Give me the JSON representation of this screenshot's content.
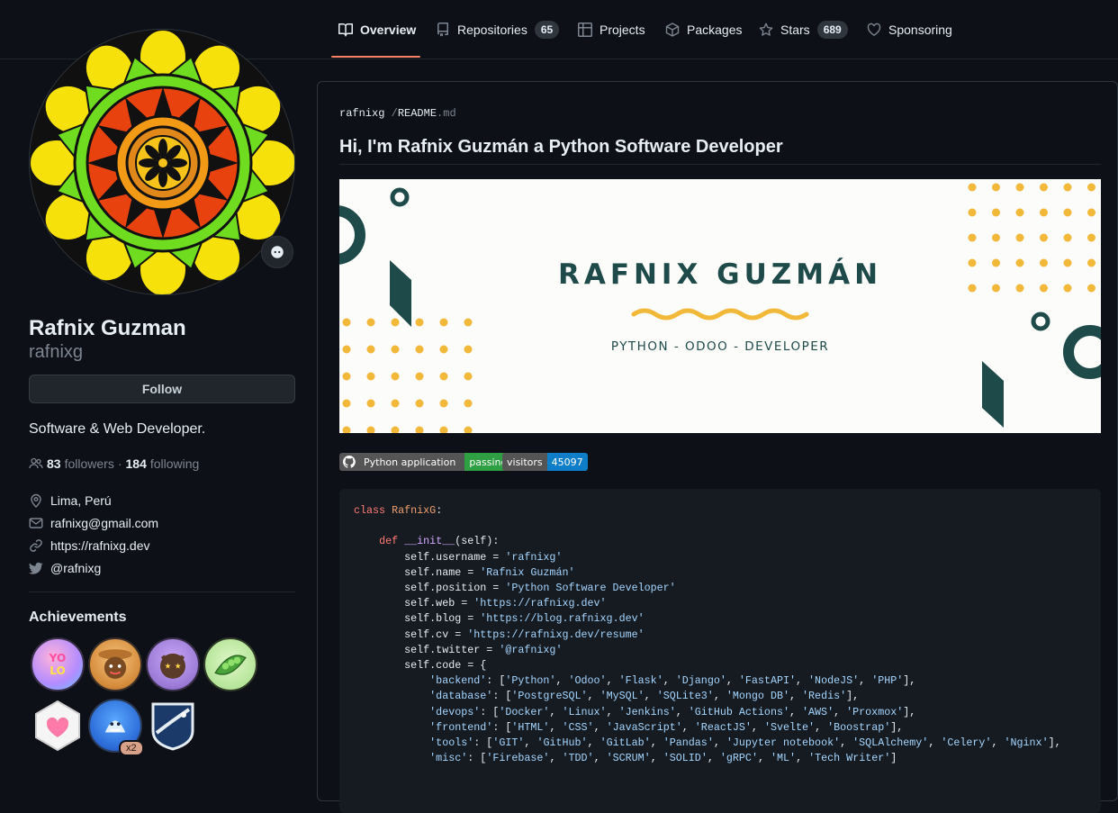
{
  "nav": {
    "tabs": [
      {
        "label": "Overview",
        "icon": "book-icon"
      },
      {
        "label": "Repositories",
        "icon": "repo-icon",
        "count": "65"
      },
      {
        "label": "Projects",
        "icon": "table-icon"
      },
      {
        "label": "Packages",
        "icon": "package-icon"
      },
      {
        "label": "Stars",
        "icon": "star-icon",
        "count": "689"
      },
      {
        "label": "Sponsoring",
        "icon": "heart-icon"
      }
    ]
  },
  "profile": {
    "name": "Rafnix Guzman",
    "login": "rafnixg",
    "follow_label": "Follow",
    "bio": "Software & Web Developer.",
    "followers_count": "83",
    "followers_label": "followers",
    "separator": "·",
    "following_count": "184",
    "following_label": "following",
    "location": "Lima, Perú",
    "email": "rafnixg@gmail.com",
    "website": "https://rafnixg.dev",
    "twitter": "@rafnixg",
    "achievements_title": "Achievements",
    "achievement_multiplier": "x2"
  },
  "readme": {
    "breadcrumb_user": "rafnixg",
    "breadcrumb_sep": "/",
    "breadcrumb_file": "README",
    "breadcrumb_ext": ".md",
    "title": "Hi, I'm Rafnix Guzmán a Python Software Developer",
    "banner_name": "RAFNIX GUZMÁN",
    "banner_subtitle": "PYTHON - ODOO - DEVELOPER",
    "shields": {
      "ci_label": "Python application",
      "ci_status": "passing",
      "visitors_label": "visitors",
      "visitors_count": "45097"
    },
    "code_lines": [
      "class RafnixG:",
      "",
      "    def __init__(self):",
      "        self.username = 'rafnixg'",
      "        self.name = 'Rafnix Guzmán'",
      "        self.position = 'Python Software Developer'",
      "        self.web = 'https://rafnixg.dev'",
      "        self.blog = 'https://blog.rafnixg.dev'",
      "        self.cv = 'https://rafnixg.dev/resume'",
      "        self.twitter = '@rafnixg'",
      "        self.code = {",
      "            'backend': ['Python', 'Odoo', 'Flask', 'Django', 'FastAPI', 'NodeJS', 'PHP'],",
      "            'database': ['PostgreSQL', 'MySQL', 'SQLite3', 'Mongo DB', 'Redis'],",
      "            'devops': ['Docker', 'Linux', 'Jenkins', 'GitHub Actions', 'AWS', 'Proxmox'],",
      "            'frontend': ['HTML', 'CSS', 'JavaScript', 'ReactJS', 'Svelte', 'Boostrap'],",
      "            'tools': ['GIT', 'GitHub', 'GitLab', 'Pandas', 'Jupyter notebook', 'SQLAlchemy', 'Celery', 'Nginx'],",
      "            'misc': ['Firebase', 'TDD', 'SCRUM', 'SOLID', 'gRPC', 'ML', 'Tech Writer']"
    ]
  },
  "colors": {
    "accent_underline": "#f78166",
    "banner_teal": "#1f4a4a",
    "banner_yellow": "#f2b83a",
    "shield_green": "#2ea043",
    "shield_blue": "#0e7ec9"
  }
}
